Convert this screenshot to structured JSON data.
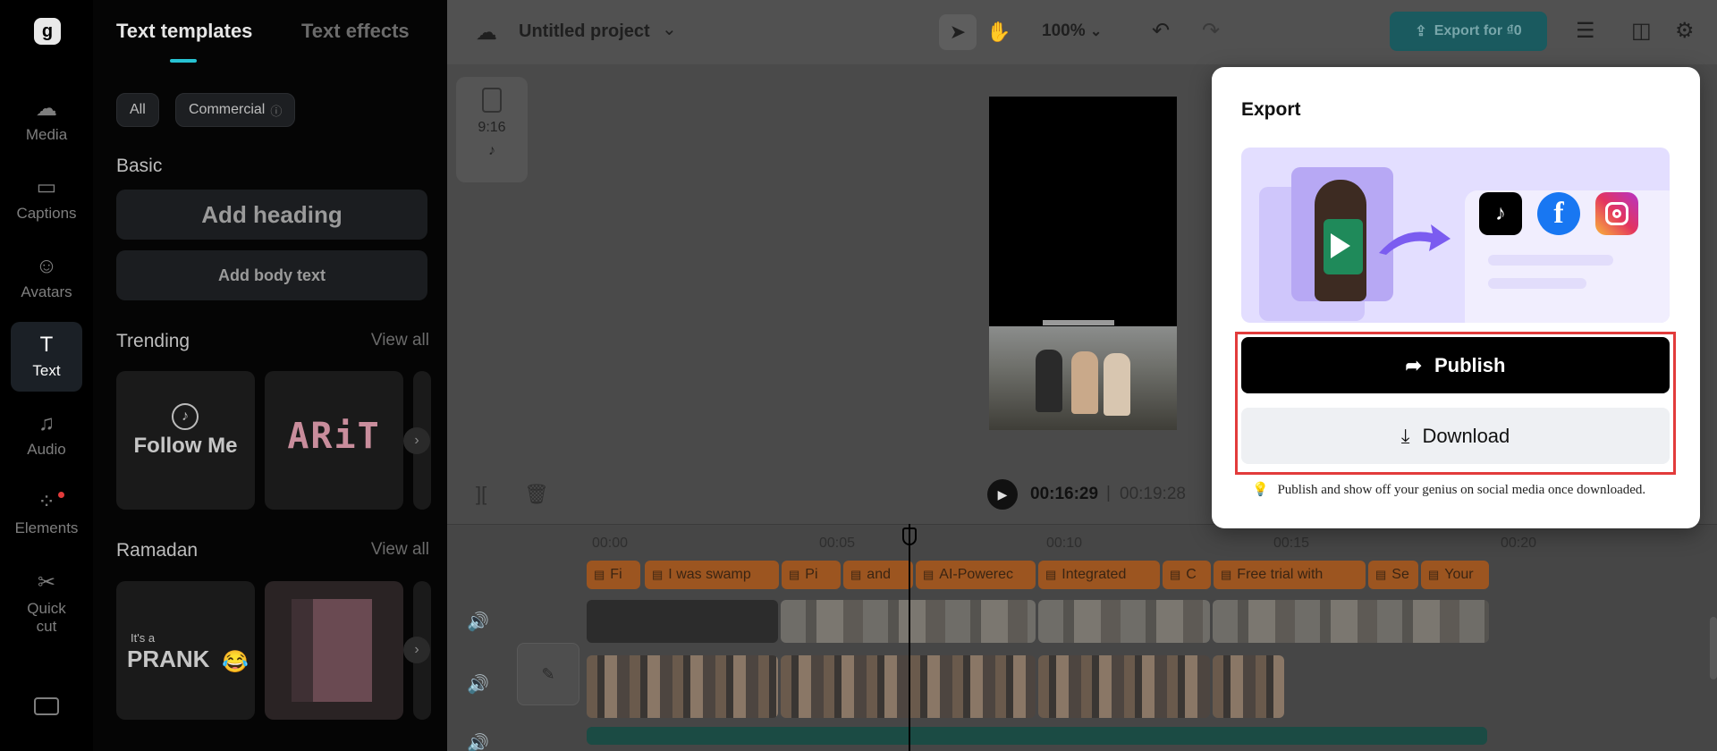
{
  "rail": {
    "items": [
      {
        "label": "Media",
        "icon": "media-cloud-icon"
      },
      {
        "label": "Captions",
        "icon": "captions-icon"
      },
      {
        "label": "Avatars",
        "icon": "avatar-icon"
      },
      {
        "label": "Text",
        "icon": "text-icon"
      },
      {
        "label": "Audio",
        "icon": "music-note-icon"
      },
      {
        "label": "Elements",
        "icon": "elements-icon"
      },
      {
        "label": "Quick cut",
        "icon": "quick-cut-icon"
      }
    ],
    "active": "Text"
  },
  "panel": {
    "tab_templates": "Text templates",
    "tab_effects": "Text effects",
    "chip_all": "All",
    "chip_commercial": "Commercial",
    "basic_title": "Basic",
    "add_heading": "Add heading",
    "add_body": "Add body text",
    "trending_title": "Trending",
    "trending_view_all": "View all",
    "trending_card1": "Follow Me",
    "trending_card2": "ARiT",
    "ramadan_title": "Ramadan",
    "ramadan_view_all": "View all",
    "ramadan_card1_small": "It's a",
    "ramadan_card1_big": "PRANK"
  },
  "topbar": {
    "project_title": "Untitled project",
    "zoom": "100%",
    "export_label": "Export for ₫0"
  },
  "ratio": {
    "label": "9:16"
  },
  "playback": {
    "current": "00:16:29",
    "separator": "|",
    "total": "00:19:28"
  },
  "timeline": {
    "ruler": [
      "00:00",
      "00:05",
      "00:10",
      "00:15",
      "00:20"
    ],
    "text_clips": [
      "Fi",
      "I was swamp",
      "Pi",
      "and",
      "AI-Powerec",
      "Integrated",
      "C",
      "Free trial with",
      "Se",
      "Your"
    ]
  },
  "export_popover": {
    "title": "Export",
    "publish_label": "Publish",
    "download_label": "Download",
    "tip": "Publish and show off your genius on social media once downloaded.",
    "social": [
      "TikTok",
      "Facebook",
      "Instagram"
    ]
  },
  "colors": {
    "accent": "#27c3d3",
    "highlight": "#e23b3b",
    "text_clip": "#9c5520",
    "export_button": "#1a5a5f"
  }
}
